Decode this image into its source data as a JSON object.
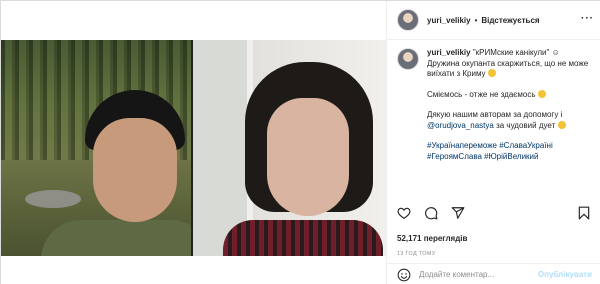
{
  "header": {
    "username": "yuri_velikiy",
    "separator": "•",
    "follow_label": "Відстежується",
    "more_label": "···"
  },
  "caption": {
    "username": "yuri_velikiy",
    "line1": "\"кРИМские канікули\" ☺",
    "line2": "Дружина окупанта скаржиться, що не може виїхати з Криму",
    "line3": "Сміємось - отже не здаємось",
    "line4": "Дякую нашим авторам за допомогу і",
    "mention": "@orudjova_nastya",
    "line4_end": "за чудовий дует",
    "hashtags": "#Українапереможе #СлаваУкраїні #ГероямСлава #ЮрійВеликий"
  },
  "stats": {
    "views": "52,171 переглядів",
    "time_ago": "13 ГОД ТОМУ"
  },
  "comment_box": {
    "placeholder": "Додайте коментар...",
    "publish_label": "Опублікувати"
  },
  "icons": [
    "heart-icon",
    "comment-icon",
    "share-icon",
    "bookmark-icon",
    "emoji-icon",
    "more-icon"
  ],
  "colors": {
    "link": "#00376b",
    "publish_disabled": "#b2dffc",
    "muted": "#8e8e8e"
  }
}
